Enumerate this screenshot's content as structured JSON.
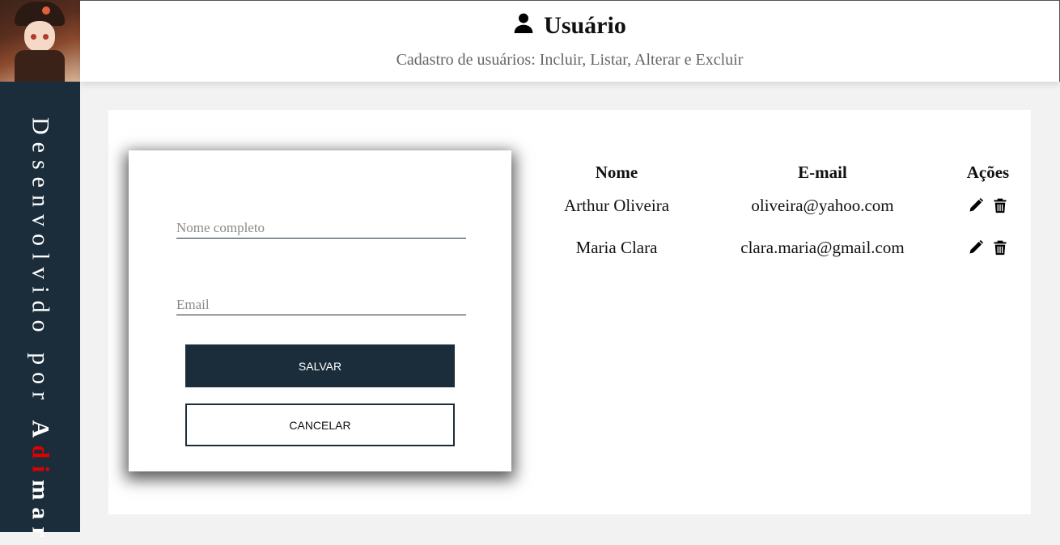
{
  "header": {
    "title": "Usuário",
    "subtitle": "Cadastro de usuários: Incluir, Listar, Alterar e Excluir",
    "icon": "user-icon"
  },
  "sidebar": {
    "prefix": "Desenvolvido por",
    "name_a1": "A",
    "name_red": "di",
    "name_rest": "mar"
  },
  "form": {
    "name_placeholder": "Nome completo",
    "email_placeholder": "Email",
    "save_label": "SALVAR",
    "cancel_label": "CANCELAR"
  },
  "table": {
    "headers": [
      "Nome",
      "E-mail",
      "Ações"
    ],
    "rows": [
      {
        "name": "Arthur Oliveira",
        "email": "oliveira@yahoo.com"
      },
      {
        "name": "Maria Clara",
        "email": "clara.maria@gmail.com"
      }
    ]
  },
  "colors": {
    "primary": "#1b2d3a",
    "accent_red": "#e00000"
  }
}
